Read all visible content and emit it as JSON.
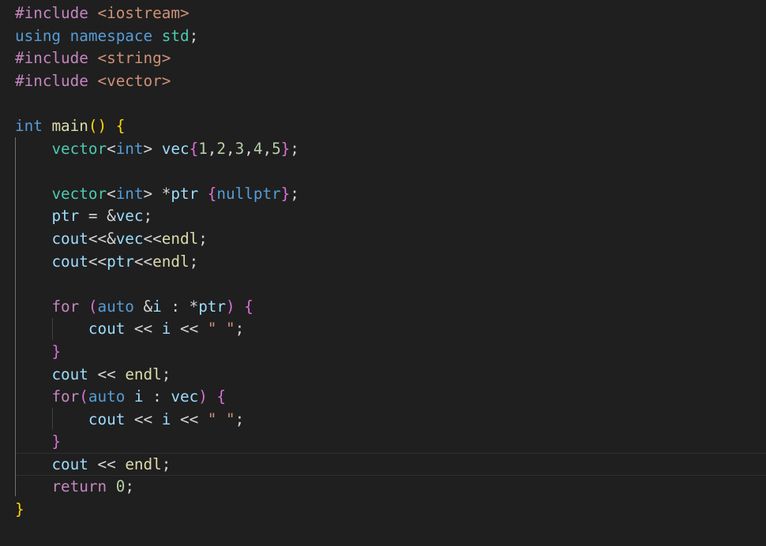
{
  "editor": {
    "colors": {
      "background": "#1f1f1f",
      "preprocessor": "#c586c0",
      "include_path": "#ce9178",
      "keyword": "#569cd6",
      "type": "#4ec9b0",
      "function": "#dcdcaa",
      "variable": "#9cdcfe",
      "number": "#b5cea8",
      "string": "#ce9178",
      "bracket_level1": "#ffd700",
      "bracket_level2": "#da70d6",
      "bracket_level3": "#179fff"
    },
    "lines": [
      [
        [
          "preprocessor",
          "#include "
        ],
        [
          "include-path",
          "<iostream>"
        ]
      ],
      [
        [
          "keyword",
          "using"
        ],
        [
          "plain",
          " "
        ],
        [
          "keyword",
          "namespace"
        ],
        [
          "plain",
          " "
        ],
        [
          "namespace",
          "std"
        ],
        [
          "plain",
          ";"
        ]
      ],
      [
        [
          "preprocessor",
          "#include "
        ],
        [
          "include-path",
          "<string>"
        ]
      ],
      [
        [
          "preprocessor",
          "#include "
        ],
        [
          "include-path",
          "<vector>"
        ]
      ],
      [],
      [
        [
          "keyword",
          "int"
        ],
        [
          "plain",
          " "
        ],
        [
          "function",
          "main"
        ],
        [
          "bracket1",
          "()"
        ],
        [
          "plain",
          " "
        ],
        [
          "bracket1",
          "{"
        ]
      ],
      [
        [
          "plain",
          "    "
        ],
        [
          "type",
          "vector"
        ],
        [
          "plain",
          "<"
        ],
        [
          "keyword",
          "int"
        ],
        [
          "plain",
          "> "
        ],
        [
          "variable",
          "vec"
        ],
        [
          "bracket2",
          "{"
        ],
        [
          "number",
          "1"
        ],
        [
          "plain",
          ","
        ],
        [
          "number",
          "2"
        ],
        [
          "plain",
          ","
        ],
        [
          "number",
          "3"
        ],
        [
          "plain",
          ","
        ],
        [
          "number",
          "4"
        ],
        [
          "plain",
          ","
        ],
        [
          "number",
          "5"
        ],
        [
          "bracket2",
          "}"
        ],
        [
          "plain",
          ";"
        ]
      ],
      [],
      [
        [
          "plain",
          "    "
        ],
        [
          "type",
          "vector"
        ],
        [
          "plain",
          "<"
        ],
        [
          "keyword",
          "int"
        ],
        [
          "plain",
          "> *"
        ],
        [
          "variable",
          "ptr"
        ],
        [
          "plain",
          " "
        ],
        [
          "bracket2",
          "{"
        ],
        [
          "keyword",
          "nullptr"
        ],
        [
          "bracket2",
          "}"
        ],
        [
          "plain",
          ";"
        ]
      ],
      [
        [
          "plain",
          "    "
        ],
        [
          "variable",
          "ptr"
        ],
        [
          "plain",
          " = &"
        ],
        [
          "variable",
          "vec"
        ],
        [
          "plain",
          ";"
        ]
      ],
      [
        [
          "plain",
          "    "
        ],
        [
          "variable",
          "cout"
        ],
        [
          "plain",
          "<<&"
        ],
        [
          "variable",
          "vec"
        ],
        [
          "plain",
          "<<"
        ],
        [
          "function",
          "endl"
        ],
        [
          "plain",
          ";"
        ]
      ],
      [
        [
          "plain",
          "    "
        ],
        [
          "variable",
          "cout"
        ],
        [
          "plain",
          "<<"
        ],
        [
          "variable",
          "ptr"
        ],
        [
          "plain",
          "<<"
        ],
        [
          "function",
          "endl"
        ],
        [
          "plain",
          ";"
        ]
      ],
      [],
      [
        [
          "plain",
          "    "
        ],
        [
          "control",
          "for"
        ],
        [
          "plain",
          " "
        ],
        [
          "bracket2",
          "("
        ],
        [
          "keyword",
          "auto"
        ],
        [
          "plain",
          " &"
        ],
        [
          "variable",
          "i"
        ],
        [
          "plain",
          " : *"
        ],
        [
          "variable",
          "ptr"
        ],
        [
          "bracket2",
          ")"
        ],
        [
          "plain",
          " "
        ],
        [
          "bracket2",
          "{"
        ]
      ],
      [
        [
          "plain",
          "        "
        ],
        [
          "variable",
          "cout"
        ],
        [
          "plain",
          " << "
        ],
        [
          "variable",
          "i"
        ],
        [
          "plain",
          " << "
        ],
        [
          "string",
          "\" \""
        ],
        [
          "plain",
          ";"
        ]
      ],
      [
        [
          "plain",
          "    "
        ],
        [
          "bracket2",
          "}"
        ]
      ],
      [
        [
          "plain",
          "    "
        ],
        [
          "variable",
          "cout"
        ],
        [
          "plain",
          " << "
        ],
        [
          "function",
          "endl"
        ],
        [
          "plain",
          ";"
        ]
      ],
      [
        [
          "plain",
          "    "
        ],
        [
          "control",
          "for"
        ],
        [
          "bracket2",
          "("
        ],
        [
          "keyword",
          "auto"
        ],
        [
          "plain",
          " "
        ],
        [
          "variable",
          "i"
        ],
        [
          "plain",
          " : "
        ],
        [
          "variable",
          "vec"
        ],
        [
          "bracket2",
          ")"
        ],
        [
          "plain",
          " "
        ],
        [
          "bracket2",
          "{"
        ]
      ],
      [
        [
          "plain",
          "        "
        ],
        [
          "variable",
          "cout"
        ],
        [
          "plain",
          " << "
        ],
        [
          "variable",
          "i"
        ],
        [
          "plain",
          " << "
        ],
        [
          "string",
          "\" \""
        ],
        [
          "plain",
          ";"
        ]
      ],
      [
        [
          "plain",
          "    "
        ],
        [
          "bracket2",
          "}"
        ]
      ],
      [
        [
          "plain",
          "    "
        ],
        [
          "variable",
          "cout"
        ],
        [
          "plain",
          " << "
        ],
        [
          "function",
          "endl"
        ],
        [
          "plain",
          ";"
        ]
      ],
      [
        [
          "plain",
          "    "
        ],
        [
          "control",
          "return"
        ],
        [
          "plain",
          " "
        ],
        [
          "number",
          "0"
        ],
        [
          "plain",
          ";"
        ]
      ],
      [
        [
          "bracket1",
          "}"
        ]
      ]
    ]
  }
}
